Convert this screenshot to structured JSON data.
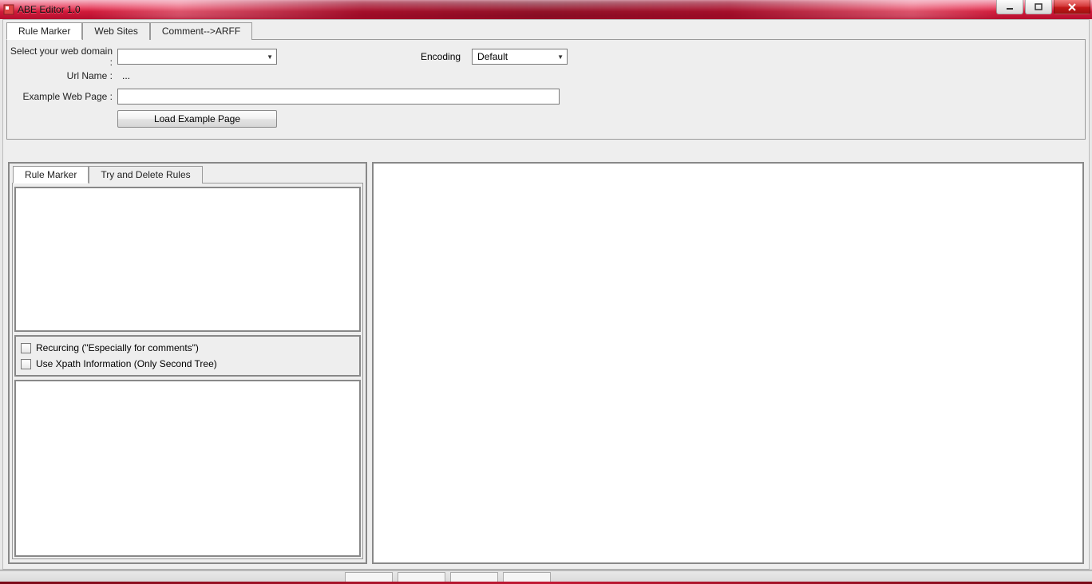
{
  "window": {
    "title": "ABE Editor 1.0",
    "min_btn": "minimize",
    "max_btn": "maximize",
    "close_btn": "close"
  },
  "top_tabs": {
    "t1": "Rule Marker",
    "t2": "Web Sites",
    "t3": "Comment-->ARFF"
  },
  "form": {
    "domain_label": "Select your web domain :",
    "domain_value": "",
    "url_label": "Url Name :",
    "url_value": "...",
    "example_label": "Example Web Page :",
    "example_value": "",
    "encoding_label": "Encoding",
    "encoding_value": "Default",
    "load_btn": "Load Example Page"
  },
  "inner_tabs": {
    "t1": "Rule Marker",
    "t2": "Try and Delete Rules"
  },
  "opts": {
    "recurcing": "Recurcing (\"Especially for comments\")",
    "xpath": "Use Xpath Information (Only Second Tree)"
  }
}
